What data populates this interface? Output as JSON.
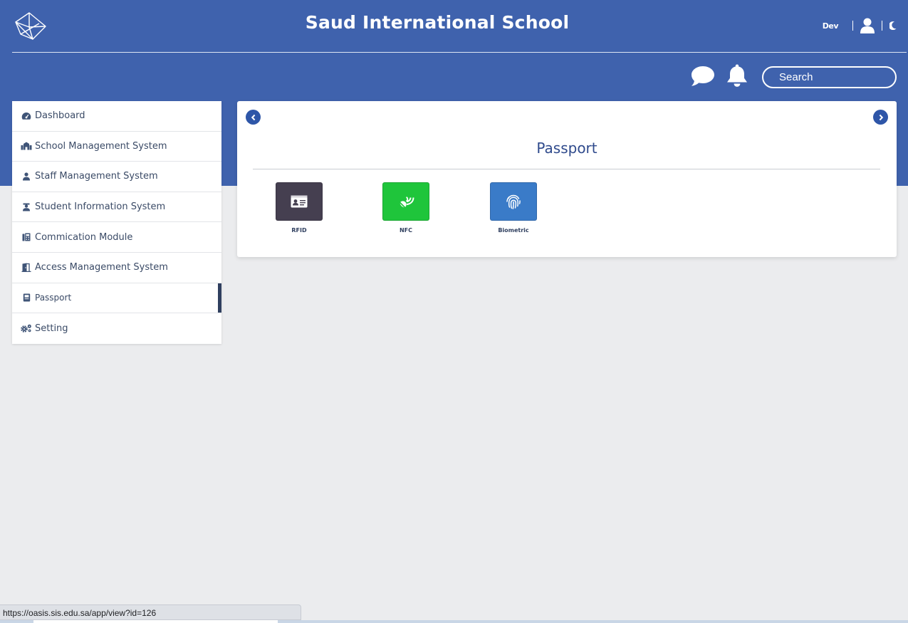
{
  "header": {
    "title": "Saud International School",
    "user_name": "Dev",
    "logo_icon": "cube-logo-icon",
    "user_icon": "user-icon",
    "theme_icon": "moon-icon",
    "chat_icon": "chat-bubble-icon",
    "bell_icon": "bell-icon"
  },
  "search": {
    "placeholder": "Search"
  },
  "sidebar": {
    "items": [
      {
        "label": "Dashboard",
        "icon": "dashboard-icon"
      },
      {
        "label": "School Management System",
        "icon": "school-icon"
      },
      {
        "label": "Staff Management System",
        "icon": "staff-icon"
      },
      {
        "label": "Student Information System",
        "icon": "student-icon"
      },
      {
        "label": "Commication Module",
        "icon": "communication-icon"
      },
      {
        "label": "Access Management System",
        "icon": "door-icon"
      },
      {
        "label": "Passport",
        "icon": "passport-icon",
        "active": true
      },
      {
        "label": "Setting",
        "icon": "gears-icon"
      }
    ]
  },
  "main": {
    "title": "Passport",
    "tiles": [
      {
        "label": "RFID",
        "icon": "id-card-icon",
        "color": "#453f50"
      },
      {
        "label": "NFC",
        "icon": "nfc-signal-icon",
        "color": "#1fc53b"
      },
      {
        "label": "Biometric",
        "icon": "fingerprint-icon",
        "color": "#3a7bc8"
      }
    ]
  },
  "status_bar": {
    "url": "https://oasis.sis.edu.sa/app/view?id=126"
  },
  "colors": {
    "header_bg": "#3f62ad",
    "page_bg": "#ebecee",
    "accent": "#2e56a8"
  }
}
